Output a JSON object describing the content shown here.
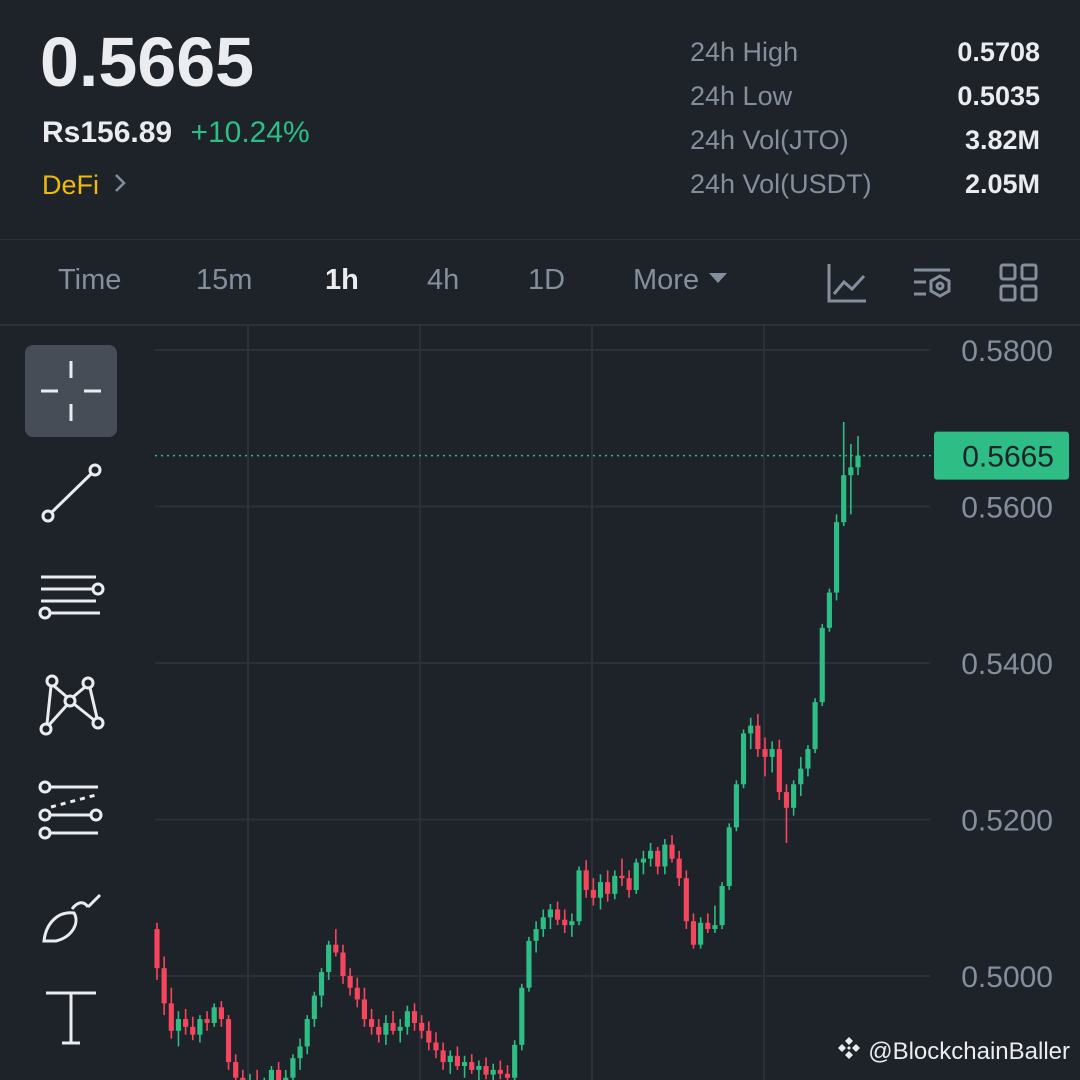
{
  "ticker": {
    "price": "0.5665",
    "fiat_price": "Rs156.89",
    "change_pct": "+10.24%",
    "category": "DeFi"
  },
  "stats": [
    {
      "label": "24h High",
      "value": "0.5708"
    },
    {
      "label": "24h Low",
      "value": "0.5035"
    },
    {
      "label": "24h Vol(JTO)",
      "value": "3.82M"
    },
    {
      "label": "24h Vol(USDT)",
      "value": "2.05M"
    }
  ],
  "tabs": [
    {
      "label": "Time",
      "active": false
    },
    {
      "label": "15m",
      "active": false
    },
    {
      "label": "1h",
      "active": true
    },
    {
      "label": "4h",
      "active": false
    },
    {
      "label": "1D",
      "active": false
    },
    {
      "label": "More",
      "active": false
    }
  ],
  "tab_icons": [
    "indicator-icon",
    "chart-settings-icon",
    "layout-grid-icon"
  ],
  "drawing_tools": [
    "crosshair-icon",
    "trend-line-icon",
    "horizontal-lines-icon",
    "pattern-icon",
    "fib-channel-icon",
    "brush-icon",
    "text-icon"
  ],
  "watermark": "@BlockchainBaller",
  "colors": {
    "up": "#2ebd85",
    "down": "#f6465d",
    "accent": "#f0b90b",
    "background": "#1e2329"
  },
  "chart_data": {
    "type": "candlestick",
    "timeframe": "1h",
    "y_ticks": [
      "0.5800",
      "0.5600",
      "0.5400",
      "0.5200",
      "0.5000"
    ],
    "ylim": [
      0.487,
      0.583
    ],
    "current_price": "0.5665",
    "candles": [
      [
        0.506,
        0.5068,
        0.4995,
        0.501
      ],
      [
        0.501,
        0.5025,
        0.495,
        0.4965
      ],
      [
        0.4965,
        0.4985,
        0.492,
        0.493
      ],
      [
        0.493,
        0.4955,
        0.491,
        0.4945
      ],
      [
        0.4945,
        0.4958,
        0.4925,
        0.4935
      ],
      [
        0.4935,
        0.4948,
        0.4918,
        0.4925
      ],
      [
        0.4925,
        0.495,
        0.4915,
        0.4945
      ],
      [
        0.4945,
        0.4955,
        0.493,
        0.494
      ],
      [
        0.494,
        0.4965,
        0.4935,
        0.496
      ],
      [
        0.496,
        0.4968,
        0.4935,
        0.4945
      ],
      [
        0.4945,
        0.495,
        0.488,
        0.489
      ],
      [
        0.489,
        0.49,
        0.486,
        0.487
      ],
      [
        0.487,
        0.488,
        0.485,
        0.486
      ],
      [
        0.486,
        0.4875,
        0.4845,
        0.4865
      ],
      [
        0.4865,
        0.488,
        0.485,
        0.4855
      ],
      [
        0.4855,
        0.487,
        0.484,
        0.486
      ],
      [
        0.486,
        0.4885,
        0.485,
        0.488
      ],
      [
        0.488,
        0.489,
        0.486,
        0.4865
      ],
      [
        0.4865,
        0.488,
        0.485,
        0.487
      ],
      [
        0.487,
        0.49,
        0.486,
        0.4895
      ],
      [
        0.4895,
        0.492,
        0.488,
        0.491
      ],
      [
        0.491,
        0.495,
        0.49,
        0.4945
      ],
      [
        0.4945,
        0.498,
        0.4935,
        0.4975
      ],
      [
        0.4975,
        0.501,
        0.496,
        0.5005
      ],
      [
        0.5005,
        0.5045,
        0.4995,
        0.504
      ],
      [
        0.504,
        0.506,
        0.5025,
        0.503
      ],
      [
        0.503,
        0.504,
        0.499,
        0.5
      ],
      [
        0.5,
        0.501,
        0.4975,
        0.4985
      ],
      [
        0.4985,
        0.4998,
        0.496,
        0.497
      ],
      [
        0.497,
        0.4985,
        0.4935,
        0.4945
      ],
      [
        0.4945,
        0.4958,
        0.4925,
        0.4935
      ],
      [
        0.4935,
        0.4945,
        0.4915,
        0.4925
      ],
      [
        0.4925,
        0.495,
        0.4912,
        0.494
      ],
      [
        0.494,
        0.4955,
        0.4925,
        0.493
      ],
      [
        0.493,
        0.4945,
        0.4915,
        0.4935
      ],
      [
        0.4935,
        0.4962,
        0.4925,
        0.4955
      ],
      [
        0.4955,
        0.4965,
        0.493,
        0.494
      ],
      [
        0.494,
        0.495,
        0.492,
        0.493
      ],
      [
        0.493,
        0.4942,
        0.4905,
        0.4915
      ],
      [
        0.4915,
        0.4928,
        0.4895,
        0.4905
      ],
      [
        0.4905,
        0.4915,
        0.488,
        0.489
      ],
      [
        0.489,
        0.4905,
        0.4875,
        0.4898
      ],
      [
        0.4898,
        0.491,
        0.488,
        0.4885
      ],
      [
        0.4885,
        0.4898,
        0.487,
        0.489
      ],
      [
        0.489,
        0.49,
        0.4875,
        0.488
      ],
      [
        0.488,
        0.4892,
        0.4865,
        0.4885
      ],
      [
        0.4885,
        0.4896,
        0.4868,
        0.4874
      ],
      [
        0.4874,
        0.4888,
        0.4862,
        0.488
      ],
      [
        0.488,
        0.4892,
        0.4868,
        0.4875
      ],
      [
        0.4875,
        0.4886,
        0.486,
        0.487
      ],
      [
        0.487,
        0.4918,
        0.4865,
        0.4912
      ],
      [
        0.4912,
        0.499,
        0.4905,
        0.4985
      ],
      [
        0.4985,
        0.505,
        0.498,
        0.5045
      ],
      [
        0.5045,
        0.507,
        0.503,
        0.506
      ],
      [
        0.506,
        0.5085,
        0.505,
        0.5075
      ],
      [
        0.5075,
        0.5092,
        0.506,
        0.5085
      ],
      [
        0.5085,
        0.5095,
        0.5065,
        0.5072
      ],
      [
        0.5072,
        0.5085,
        0.5055,
        0.5065
      ],
      [
        0.5065,
        0.508,
        0.505,
        0.507
      ],
      [
        0.507,
        0.514,
        0.5065,
        0.5135
      ],
      [
        0.5135,
        0.5148,
        0.51,
        0.511
      ],
      [
        0.511,
        0.5125,
        0.509,
        0.51
      ],
      [
        0.51,
        0.513,
        0.5085,
        0.512
      ],
      [
        0.512,
        0.5135,
        0.5095,
        0.5105
      ],
      [
        0.5105,
        0.5135,
        0.5098,
        0.5128
      ],
      [
        0.5128,
        0.515,
        0.5115,
        0.5125
      ],
      [
        0.5125,
        0.5135,
        0.51,
        0.511
      ],
      [
        0.511,
        0.515,
        0.5105,
        0.5145
      ],
      [
        0.5145,
        0.516,
        0.513,
        0.515
      ],
      [
        0.515,
        0.517,
        0.514,
        0.516
      ],
      [
        0.516,
        0.5165,
        0.513,
        0.514
      ],
      [
        0.514,
        0.5175,
        0.513,
        0.5168
      ],
      [
        0.5168,
        0.518,
        0.5145,
        0.515
      ],
      [
        0.515,
        0.516,
        0.5115,
        0.5125
      ],
      [
        0.5125,
        0.5135,
        0.506,
        0.507
      ],
      [
        0.507,
        0.508,
        0.5035,
        0.504
      ],
      [
        0.504,
        0.5075,
        0.5035,
        0.5068
      ],
      [
        0.5068,
        0.508,
        0.5055,
        0.506
      ],
      [
        0.506,
        0.509,
        0.5055,
        0.5065
      ],
      [
        0.5065,
        0.512,
        0.506,
        0.5115
      ],
      [
        0.5115,
        0.5195,
        0.511,
        0.519
      ],
      [
        0.519,
        0.525,
        0.5185,
        0.5245
      ],
      [
        0.5245,
        0.5315,
        0.524,
        0.531
      ],
      [
        0.531,
        0.533,
        0.529,
        0.532
      ],
      [
        0.532,
        0.5335,
        0.528,
        0.529
      ],
      [
        0.529,
        0.5305,
        0.5255,
        0.528
      ],
      [
        0.528,
        0.53,
        0.526,
        0.529
      ],
      [
        0.529,
        0.5302,
        0.5225,
        0.5235
      ],
      [
        0.5235,
        0.5245,
        0.517,
        0.5215
      ],
      [
        0.5215,
        0.525,
        0.5205,
        0.5245
      ],
      [
        0.5245,
        0.528,
        0.523,
        0.5265
      ],
      [
        0.5265,
        0.5295,
        0.5255,
        0.529
      ],
      [
        0.529,
        0.5355,
        0.5285,
        0.535
      ],
      [
        0.535,
        0.545,
        0.5345,
        0.5445
      ],
      [
        0.5445,
        0.5495,
        0.544,
        0.549
      ],
      [
        0.549,
        0.559,
        0.548,
        0.558
      ],
      [
        0.558,
        0.5708,
        0.5575,
        0.564
      ],
      [
        0.564,
        0.568,
        0.559,
        0.565
      ],
      [
        0.565,
        0.569,
        0.564,
        0.5665
      ]
    ]
  }
}
